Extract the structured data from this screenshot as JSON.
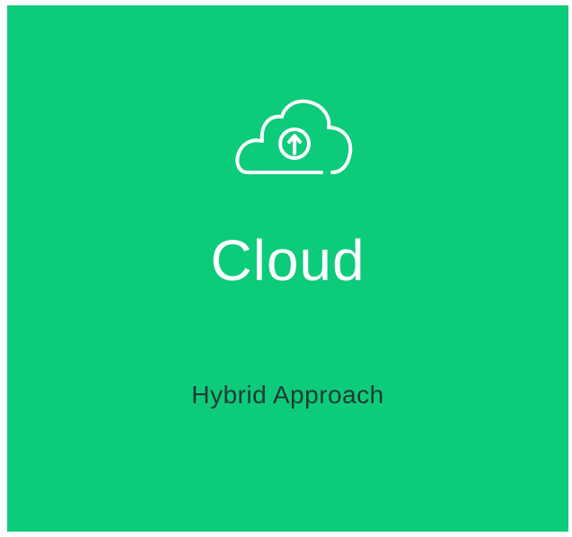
{
  "card": {
    "icon": "cloud-upload-icon",
    "title": "Cloud",
    "subtitle": "Hybrid Approach",
    "background_color": "#0ccb7a",
    "title_color": "#ffffff",
    "subtitle_color": "#1f3a33"
  }
}
